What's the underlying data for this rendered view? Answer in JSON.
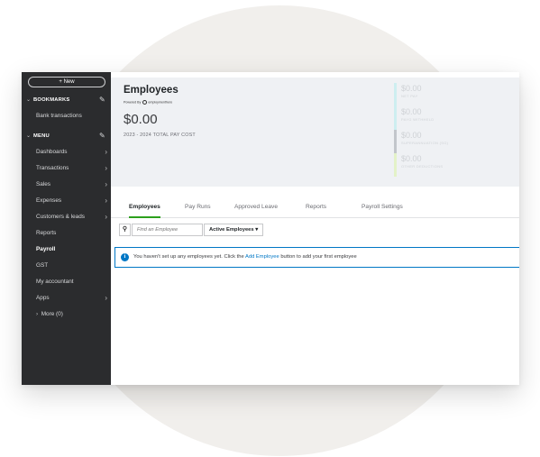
{
  "sidebar": {
    "new_label": "+ New",
    "bookmarks_label": "BOOKMARKS",
    "bookmarks_items": [
      "Bank transactions"
    ],
    "menu_label": "MENU",
    "menu_items": [
      {
        "label": "Dashboards",
        "has_arrow": true
      },
      {
        "label": "Transactions",
        "has_arrow": true
      },
      {
        "label": "Sales",
        "has_arrow": true
      },
      {
        "label": "Expenses",
        "has_arrow": true
      },
      {
        "label": "Customers & leads",
        "has_arrow": true
      },
      {
        "label": "Reports",
        "has_arrow": false
      },
      {
        "label": "Payroll",
        "has_arrow": false,
        "active": true
      },
      {
        "label": "GST",
        "has_arrow": false
      },
      {
        "label": "My accountant",
        "has_arrow": false
      },
      {
        "label": "Apps",
        "has_arrow": true
      }
    ],
    "more_label": "More (0)"
  },
  "header": {
    "title": "Employees",
    "powered_prefix": "Powered By",
    "powered_brand": "employmenthero",
    "total_amount": "$0.00",
    "total_label": "2023 - 2024 TOTAL PAY COST",
    "stats": [
      {
        "value": "$0.00",
        "label": "NET PAY",
        "color": "#cdeef0"
      },
      {
        "value": "$0.00",
        "label": "PAYG WITHHELD",
        "color": "#cdeef0"
      },
      {
        "value": "$0.00",
        "label": "SUPERANNUATION (SG)",
        "color": "#d5d8dc"
      },
      {
        "value": "$0.00",
        "label": "OTHER DEDUCTIONS",
        "color": "#e3f2c8"
      }
    ]
  },
  "tabs": [
    "Employees",
    "Pay Runs",
    "Approved Leave",
    "Reports",
    "Payroll Settings"
  ],
  "search": {
    "placeholder": "Find an Employee",
    "filter_value": "Active Employees ▾"
  },
  "info": {
    "text_before": "You haven't set up any employees yet. Click the ",
    "link": "Add Employee",
    "text_after": " button to add your first employee"
  },
  "colors": {
    "accent_green": "#2ca01c",
    "info_blue": "#0077c5",
    "sidebar_bg": "#2b2c2e"
  }
}
